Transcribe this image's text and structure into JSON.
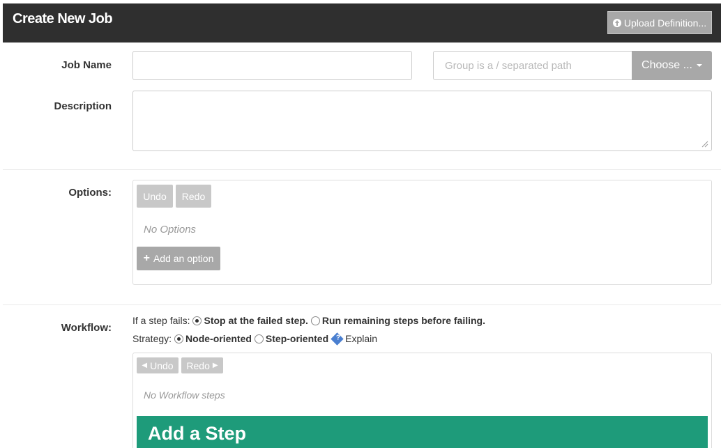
{
  "header": {
    "title": "Create New Job",
    "upload_label": "Upload Definition..."
  },
  "job_name": {
    "label": "Job Name",
    "value": "",
    "group_placeholder": "Group is a / separated path",
    "choose_label": "Choose ..."
  },
  "description": {
    "label": "Description",
    "value": ""
  },
  "options": {
    "label": "Options:",
    "undo_label": "Undo",
    "redo_label": "Redo",
    "empty_text": "No Options",
    "add_label": "Add an option"
  },
  "workflow": {
    "label": "Workflow:",
    "fail_prefix": "If a step fails:",
    "fail_options": [
      "Stop at the failed step.",
      "Run remaining steps before failing."
    ],
    "fail_selected": 0,
    "strategy_prefix": "Strategy:",
    "strategy_options": [
      "Node-oriented",
      "Step-oriented"
    ],
    "strategy_selected": 0,
    "explain_label": "Explain",
    "undo_label": "Undo",
    "redo_label": "Redo",
    "empty_text": "No Workflow steps",
    "add_step_label": "Add a Step"
  },
  "colors": {
    "header_bg": "#2f2f2f",
    "add_step_bg": "#1e9b7a",
    "button_gray": "#a8a8a8"
  }
}
